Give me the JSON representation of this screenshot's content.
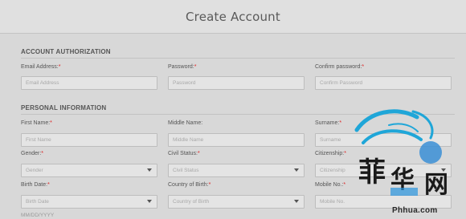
{
  "title": "Create Account",
  "sections": {
    "account": {
      "heading": "ACCOUNT AUTHORIZATION",
      "email": {
        "label": "Email Address:",
        "placeholder": "Email Address"
      },
      "password": {
        "label": "Password:",
        "placeholder": "Password"
      },
      "confirm": {
        "label": "Confirm password:",
        "placeholder": "Confirm Password"
      }
    },
    "personal": {
      "heading": "PERSONAL INFORMATION",
      "first_name": {
        "label": "First Name:",
        "placeholder": "First Name"
      },
      "middle_name": {
        "label": "Middle Name:",
        "placeholder": "Middle Name"
      },
      "surname": {
        "label": "Surname:",
        "placeholder": "Surname"
      },
      "gender": {
        "label": "Gender:",
        "value": "Gender"
      },
      "civil_status": {
        "label": "Civil Status:",
        "value": "Civil Status"
      },
      "citizenship": {
        "label": "Citizenship:",
        "value": "Citizenship"
      },
      "birth_date": {
        "label": "Birth Date:",
        "value": "Birth Date",
        "hint": "MM/DD/YYYY"
      },
      "country_of_birth": {
        "label": "Country of Birth:",
        "value": "Country of Birth"
      },
      "mobile": {
        "label": "Mobile No.:",
        "placeholder": "Mobile No."
      }
    }
  },
  "required_marker": "*",
  "watermark": {
    "text": "Phhua.com",
    "logo": "dragon-logo",
    "glyphs": "菲华网"
  }
}
